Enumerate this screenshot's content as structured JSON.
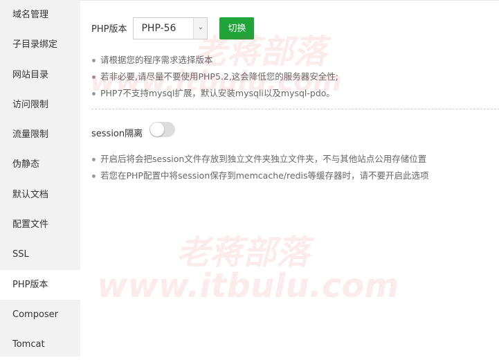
{
  "sidebar": {
    "items": [
      {
        "label": "域名管理"
      },
      {
        "label": "子目录绑定"
      },
      {
        "label": "网站目录"
      },
      {
        "label": "访问限制"
      },
      {
        "label": "流量限制"
      },
      {
        "label": "伪静态"
      },
      {
        "label": "默认文档"
      },
      {
        "label": "配置文件"
      },
      {
        "label": "SSL"
      },
      {
        "label": "PHP版本",
        "active": true
      },
      {
        "label": "Composer"
      },
      {
        "label": "Tomcat"
      }
    ]
  },
  "php": {
    "label": "PHP版本",
    "selected": "PHP-56",
    "switch_label": "切换",
    "accent": "#20a53a"
  },
  "notes1": [
    "请根据您的程序需求选择版本",
    "若非必要,请尽量不要使用PHP5.2,这会降低您的服务器安全性;",
    "PHP7不支持mysql扩展，默认安装mysqli以及mysql-pdo。"
  ],
  "session": {
    "label": "session隔离",
    "enabled": false
  },
  "notes2": [
    "开启后将会把session文件存放到独立文件夹独立文件夹，不与其他站点公用存储位置",
    "若您在PHP配置中将session保存到memcache/redis等缓存器时，请不要开启此选项"
  ],
  "watermark": {
    "cn": "老蒋部落",
    "url": "www.itbulu.com"
  }
}
